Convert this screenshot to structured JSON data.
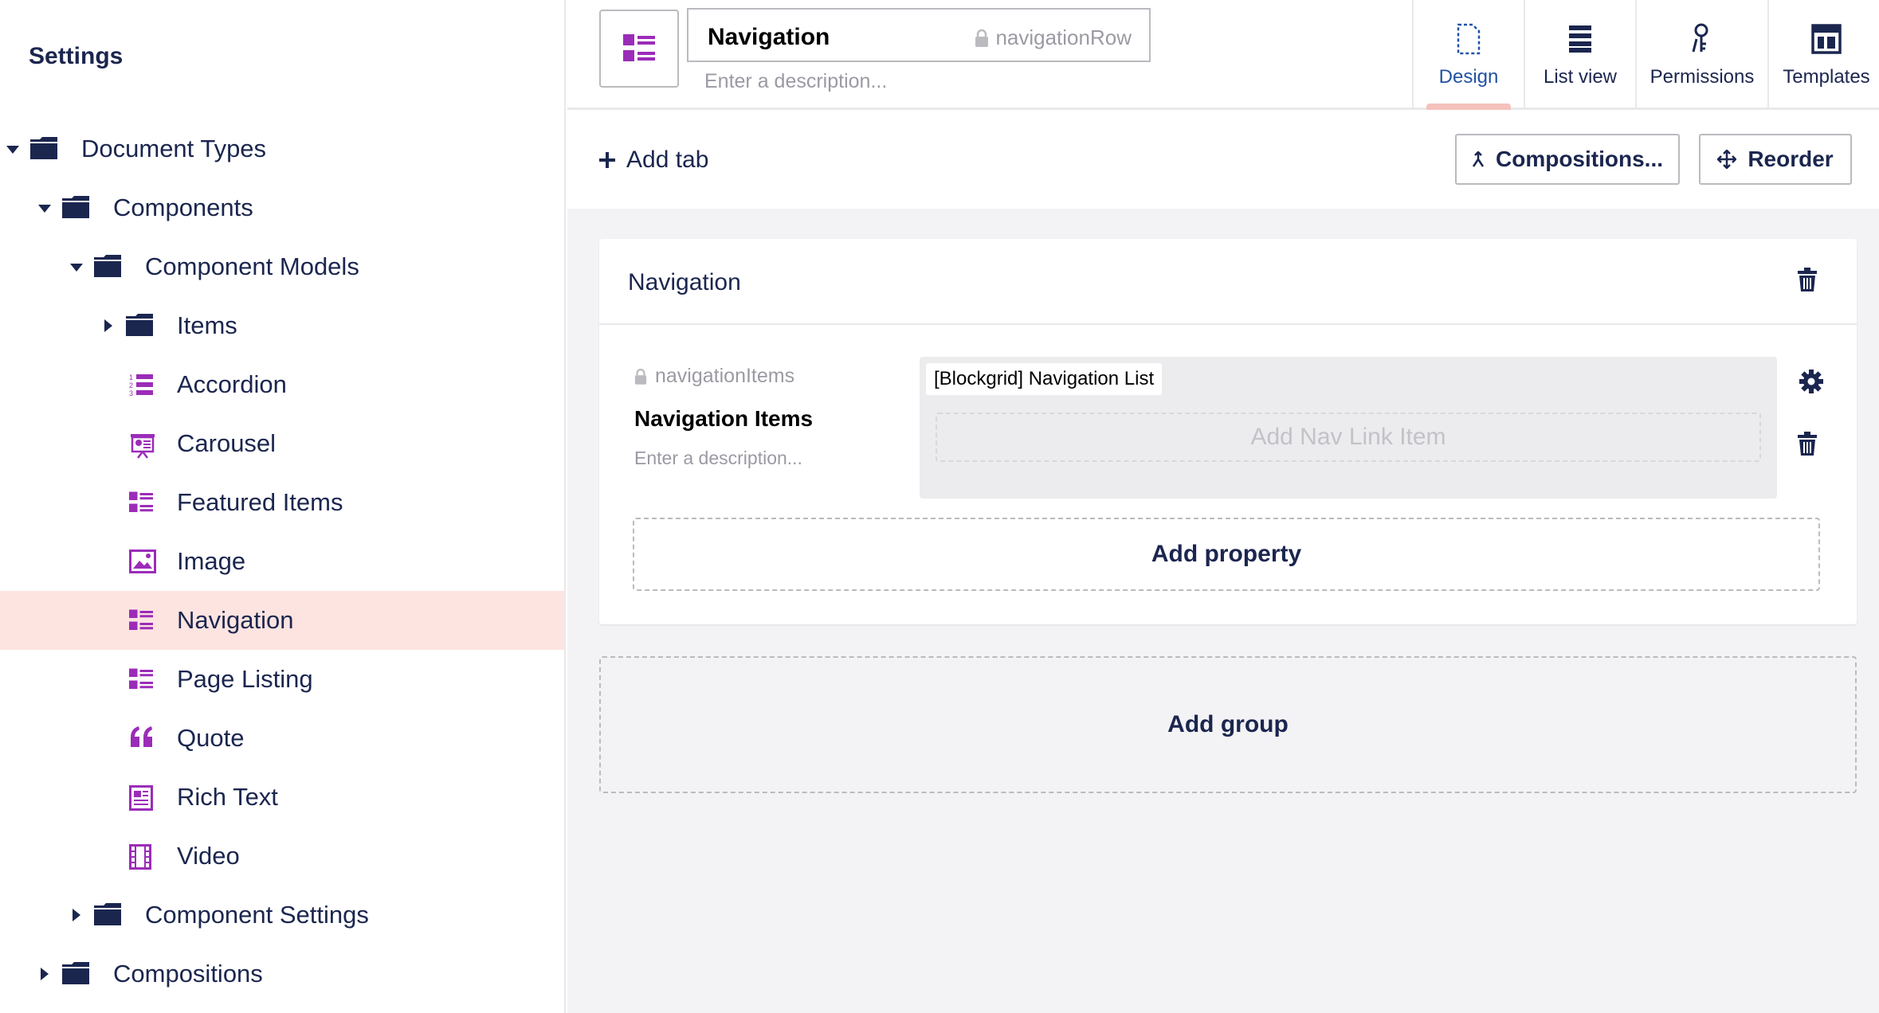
{
  "sidebar": {
    "title": "Settings",
    "items": [
      {
        "label": "Document Types",
        "icon": "folder-icon",
        "caret": "down",
        "level": 0
      },
      {
        "label": "Components",
        "icon": "folder-icon",
        "caret": "down",
        "level": 1
      },
      {
        "label": "Component Models",
        "icon": "folder-icon",
        "caret": "down",
        "level": 2
      },
      {
        "label": "Items",
        "icon": "folder-icon",
        "caret": "right",
        "level": 3
      },
      {
        "label": "Accordion",
        "icon": "ordered-list-icon",
        "caret": "none",
        "level": 3
      },
      {
        "label": "Carousel",
        "icon": "presentation-icon",
        "caret": "none",
        "level": 3
      },
      {
        "label": "Featured Items",
        "icon": "grid-list-icon",
        "caret": "none",
        "level": 3
      },
      {
        "label": "Image",
        "icon": "picture-icon",
        "caret": "none",
        "level": 3
      },
      {
        "label": "Navigation",
        "icon": "grid-list-icon",
        "caret": "none",
        "level": 3,
        "active": true
      },
      {
        "label": "Page Listing",
        "icon": "grid-list-icon",
        "caret": "none",
        "level": 3
      },
      {
        "label": "Quote",
        "icon": "quote-icon",
        "caret": "none",
        "level": 3
      },
      {
        "label": "Rich Text",
        "icon": "document-text-icon",
        "caret": "none",
        "level": 3
      },
      {
        "label": "Video",
        "icon": "film-icon",
        "caret": "none",
        "level": 3
      },
      {
        "label": "Component Settings",
        "icon": "folder-icon",
        "caret": "right",
        "level": 2
      },
      {
        "label": "Compositions",
        "icon": "folder-icon",
        "caret": "right",
        "level": 1
      }
    ]
  },
  "header": {
    "name": "Navigation",
    "alias": "navigationRow",
    "description_placeholder": "Enter a description...",
    "tabs": [
      {
        "label": "Design",
        "icon": "document-icon",
        "active": true
      },
      {
        "label": "List view",
        "icon": "list-icon",
        "active": false
      },
      {
        "label": "Permissions",
        "icon": "keys-icon",
        "active": false
      },
      {
        "label": "Templates",
        "icon": "layout-icon",
        "active": false
      }
    ]
  },
  "toolbar": {
    "add_tab": "Add tab",
    "compositions": "Compositions...",
    "reorder": "Reorder"
  },
  "group": {
    "title": "Navigation",
    "property": {
      "alias": "navigationItems",
      "name": "Navigation Items",
      "description_placeholder": "Enter a description...",
      "editor_tag": "[Blockgrid] Navigation List",
      "editor_add_label": "Add Nav Link Item"
    },
    "add_property": "Add property"
  },
  "add_group": "Add group",
  "colors": {
    "navy": "#1b264f",
    "purple": "#9b2cb8",
    "active_bg": "#fde4e1",
    "active_indicator": "#f5c1bc",
    "content_bg": "#f3f3f5"
  }
}
